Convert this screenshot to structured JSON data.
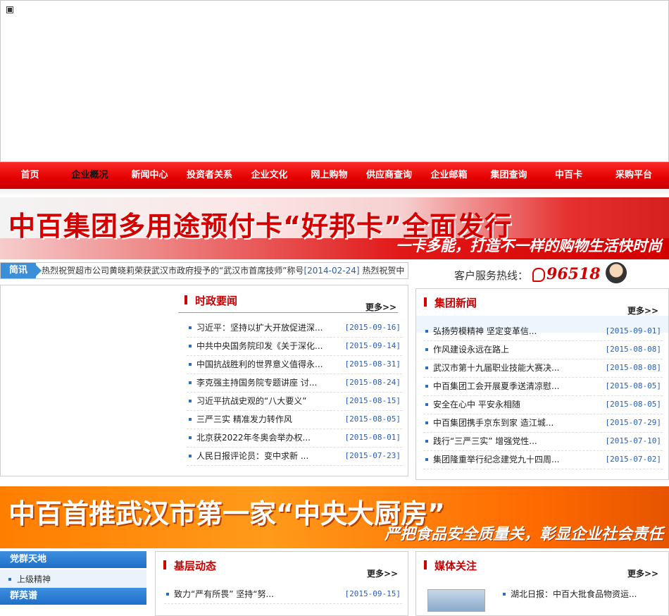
{
  "nav": {
    "items": [
      "首页",
      "企业概况",
      "新闻中心",
      "投资者关系",
      "企业文化",
      "网上购物",
      "供应商查询",
      "企业邮箱",
      "集团查询",
      "中百卡",
      "采购平台"
    ],
    "active_index": 1
  },
  "banner1": {
    "headline": "中百集团多用途预付卡“好邦卡”全面发行",
    "slogan": "一卡多能，打造不一样的购物生活快时尚"
  },
  "ticker": {
    "label": "简讯",
    "text": "热烈祝贺超市公司黄晓莉荣获武汉市政府授予的“武汉市首席技师”称号",
    "date": "[2014-02-24]",
    "next_text": "热烈祝贺中"
  },
  "hotline": {
    "label": "客户服务热线：",
    "number": "96518"
  },
  "politics_news": {
    "title": "时政要闻",
    "more": "更多>>",
    "items": [
      {
        "title": "习近平：坚持以扩大开放促进深...",
        "date": "[2015-09-16]"
      },
      {
        "title": "中共中央国务院印发《关于深化...",
        "date": "[2015-09-14]"
      },
      {
        "title": "中国抗战胜利的世界意义值得永...",
        "date": "[2015-08-31]"
      },
      {
        "title": "李克强主持国务院专题讲座 讨...",
        "date": "[2015-08-24]"
      },
      {
        "title": "习近平抗战史观的“八大要义”",
        "date": "[2015-08-15]"
      },
      {
        "title": "三严三实 精准发力转作风",
        "date": "[2015-08-05]"
      },
      {
        "title": "北京获2022年冬奥会举办权...",
        "date": "[2015-08-01]"
      },
      {
        "title": "人民日报评论员：变中求新 ...",
        "date": "[2015-07-23]"
      }
    ]
  },
  "group_news": {
    "title": "集团新闻",
    "more": "更多>>",
    "items": [
      {
        "title": "弘扬劳模精神 坚定变革信...",
        "date": "[2015-09-01]"
      },
      {
        "title": "作风建设永远在路上",
        "date": "[2015-08-08]"
      },
      {
        "title": "武汉市第十九届职业技能大赛决...",
        "date": "[2015-08-08]"
      },
      {
        "title": "中百集团工会开展夏季送清凉慰...",
        "date": "[2015-08-05]"
      },
      {
        "title": "安全在心中 平安永相随",
        "date": "[2015-08-05]"
      },
      {
        "title": "中百集团携手京东到家 造江城...",
        "date": "[2015-07-29]"
      },
      {
        "title": "践行“三严三实” 增强党性...",
        "date": "[2015-07-10]"
      },
      {
        "title": "集团隆重举行纪念建党九十四周...",
        "date": "[2015-07-02]"
      }
    ]
  },
  "banner2": {
    "headline": "中百首推武汉市第一家“中央大厨房”",
    "slogan": "严把食品安全质量关，彰显企业社会责任"
  },
  "sidebar": {
    "section1": "党群天地",
    "item1": "上级精神",
    "section2": "群英谱"
  },
  "grassroots": {
    "title": "基层动态",
    "more": "更多>>",
    "items": [
      {
        "title": "致力“严有所畏” 坚持“努...",
        "date": "[2015-09-15]"
      }
    ]
  },
  "media": {
    "title": "媒体关注",
    "more": "更多>>",
    "items": [
      {
        "title": "湖北日报：中百大批食品物资运..."
      }
    ]
  }
}
